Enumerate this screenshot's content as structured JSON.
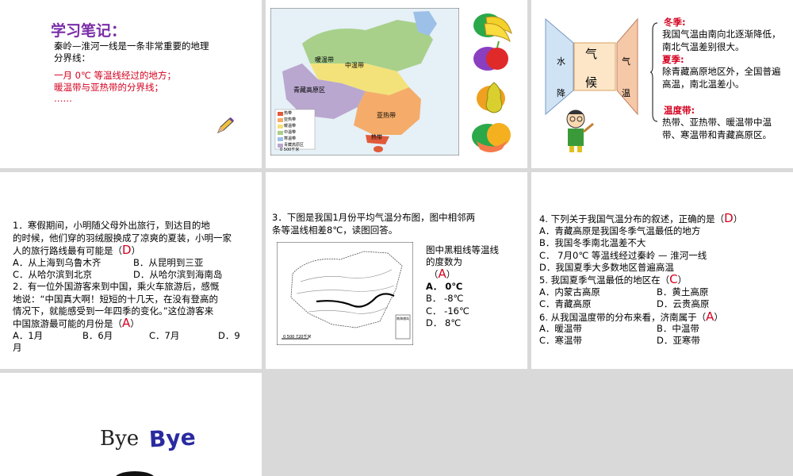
{
  "slide1": {
    "title": "学习笔记：",
    "line1": "秦岭—淮河一线是一条非常重要的地理",
    "line2": "分界线：",
    "red1": "一月 0℃ 等温线经过的地方；",
    "red2": "暖温带与亚热带的分界线；",
    "red3": "……"
  },
  "slide2": {
    "map_labels": [
      "中温带",
      "暖温带",
      "青藏高原区",
      "亚热带",
      "热带"
    ],
    "legend": [
      "热带",
      "亚热带",
      "暖温带",
      "中温带",
      "寒温带",
      "青藏高原区"
    ],
    "scale": "0     500千米"
  },
  "slide3": {
    "center": "气",
    "center2": "候",
    "left_side": "水 降",
    "right_side": "气 温",
    "winter_head": "冬季:",
    "winter_text": "我国气温由南向北逐渐降低，南北气温差别很大。",
    "summer_head": "夏季:",
    "summer_text": "除青藏高原地区外，全国普遍高温，南北温差小。",
    "zone_head": "温度带:",
    "zone_text": "热带、亚热带、暖温带中温带、寒温带和青藏高原区。"
  },
  "slide4": {
    "q1a": "1．寒假期间，小明随父母外出旅行，到达目的地",
    "q1b": "的时候，他们穿的羽绒服换成了凉爽的夏装，小明一家",
    "q1c": "人的旅行路线最有可能是（",
    "q1_ans": "D",
    "q1_end": "）",
    "q1_opt1a": "A．从上海到乌鲁木齐",
    "q1_opt1b": "B．从昆明到三亚",
    "q1_opt2a": "C．从哈尔滨到北京",
    "q1_opt2b": "D．从哈尔滨到海南岛",
    "q2a": "2．有一位外国游客来到中国，乘火车旅游后，感慨",
    "q2b": "地说：“中国真大啊！短短的十几天，在没有登高的",
    "q2c": "情况下，就能感受到一年四季的变化。”这位游客来",
    "q2d": "中国旅游最可能的月份是（",
    "q2_ans": "A",
    "q2_end": "）",
    "q2_opts": [
      "A．1月",
      "B．6月",
      "C．7月",
      "D．9"
    ],
    "q2_tail": "月"
  },
  "slide5": {
    "q3a": "3．下图是我国1月份平均气温分布图，图中相邻两",
    "q3b": "条等温线相差8℃，读图回答。",
    "side1": "图中黑粗线等温线",
    "side2": "的度数为",
    "open": "（",
    "ans": "A",
    "close": "）",
    "opts": [
      "A．  0℃",
      "B．  -8℃",
      "C．  -16℃",
      "D．  8℃"
    ],
    "scale": "0   500 720千米",
    "inset": "南海诸岛"
  },
  "slide6": {
    "q4": "4. 下列关于我国气温分布的叙述，正确的是（",
    "q4_ans": "D",
    "q4_end": "）",
    "q4_opts": [
      "A．青藏高原是我国冬季气温最低的地方",
      "B．我国冬季南北温差不大",
      "C． 7月0℃ 等温线经过秦岭 — 淮河一线",
      "D．我国夏季大多数地区普遍高温"
    ],
    "q5": "5. 我国夏季气温最低的地区在（",
    "q5_ans": "C",
    "q5_end": "）",
    "q5_opts": [
      "A．内蒙古高原",
      "B．黄土高原",
      "C．青藏高原",
      "D．云贵高原"
    ],
    "q6": "6. 从我国温度带的分布来看，济南属于（",
    "q6_ans": "A",
    "q6_end": "）",
    "q6_opts": [
      "A．暖温带",
      "B．中温带",
      "C．寒温带",
      "D．亚寒带"
    ]
  },
  "slide7": {
    "bye1": "Bye",
    "bye2": "Bye"
  }
}
